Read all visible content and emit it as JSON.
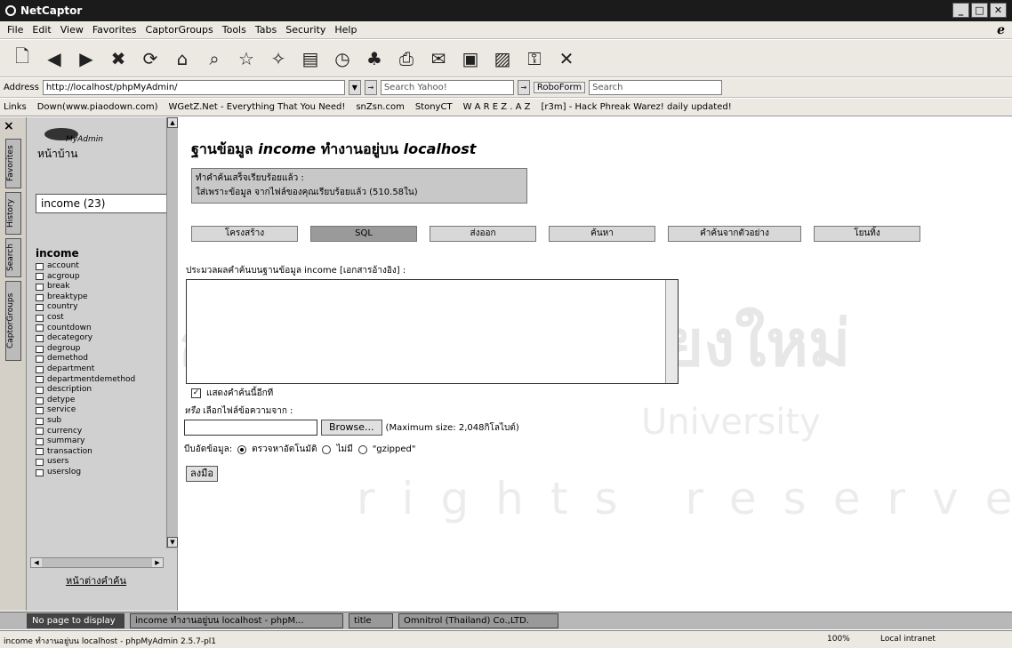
{
  "window": {
    "title": "NetCaptor"
  },
  "menu": [
    "File",
    "Edit",
    "View",
    "Favorites",
    "CaptorGroups",
    "Tools",
    "Tabs",
    "Security",
    "Help"
  ],
  "address": {
    "label": "Address",
    "url": "http://localhost/phpMyAdmin/",
    "search_placeholder": "Search Yahoo!",
    "roboform_label": "RoboForm",
    "roboform_search": "Search"
  },
  "links": {
    "label": "Links",
    "items": [
      "Down(www.piaodown.com)",
      "WGetZ.Net - Everything That You Need!",
      "snZsn.com",
      "StonyCT",
      "W A R E Z . A Z",
      "[r3m] - Hack Phreak Warez! daily updated!"
    ]
  },
  "side_tabs": [
    "Favorites",
    "History",
    "Search",
    "CaptorGroups"
  ],
  "sidebar": {
    "logo_text": "MyAdmin",
    "home_label": "หน้าบ้าน",
    "db_select": "income (23)",
    "db_name": "income",
    "tables": [
      "account",
      "acgroup",
      "break",
      "breaktype",
      "country",
      "cost",
      "countdown",
      "decategory",
      "degroup",
      "demethod",
      "department",
      "departmentdemethod",
      "description",
      "detype",
      "service",
      "sub",
      "currency",
      "summary",
      "transaction",
      "users",
      "userslog"
    ],
    "query_window_link": "หน้าต่างคำค้น"
  },
  "main": {
    "title_prefix": "ฐานข้อมูล",
    "title_db": "income",
    "title_mid": "ทำงานอยู่บน",
    "title_host": "localhost",
    "message_line1": "ทำคำค้นเสร็จเรียบร้อยแล้ว :",
    "message_line2": "ใส่เพราะข้อมูล จากไฟล์ของคุณเรียบร้อยแล้ว (510.58ใน)",
    "tabs": [
      "โครงสร้าง",
      "SQL",
      "ส่งออก",
      "ค้นหา",
      "คำค้นจากตัวอย่าง",
      "โยนทิ้ง"
    ],
    "query_label": "ประมวลผลคำค้นบนฐานข้อมูล income [เอกสารอ้างอิง] :",
    "show_query_label": "แสดงคำค้นนี้อีกที",
    "or_label_italic": "หรือ",
    "or_label_rest": "เลือกไฟล์ข้อความจาก :",
    "browse_label": "Browse...",
    "max_size": "(Maximum size: 2,048กิโลไบต์)",
    "compression_label": "บีบอัดข้อมูล:",
    "comp_options": [
      "ตรวจหาอัตโนมัติ",
      "ไม่มี",
      "\"gzipped\""
    ],
    "go_label": "ลงมือ"
  },
  "taskbar": [
    "No page to display",
    "income ทำงานอยู่บน localhost - phpM...",
    "title",
    "Omnitrol (Thailand) Co.,LTD."
  ],
  "status": {
    "text": "income ทำงานอยู่บน localhost - phpMyAdmin 2.5.7-pl1",
    "zoom": "100%",
    "zone": "Local intranet"
  },
  "watermark": {
    "line1": "กริ๊มหาวิทยาลัยเชียงใหม่",
    "line2": "University",
    "line3": "rights reserved"
  }
}
